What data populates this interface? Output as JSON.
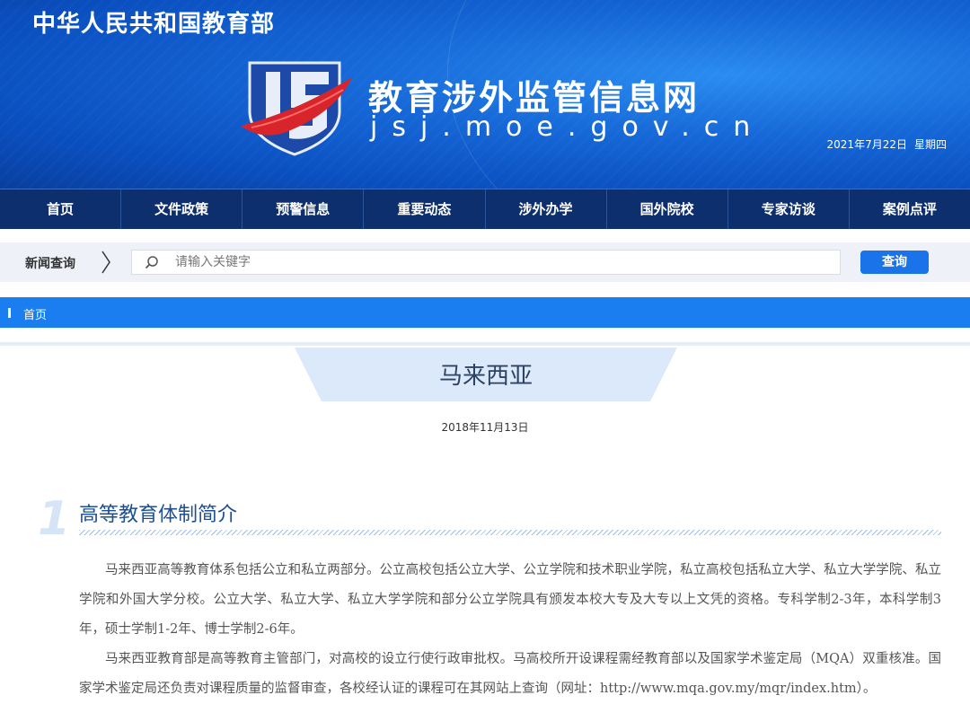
{
  "header": {
    "ministry": "中华人民共和国教育部",
    "site_title": "教育涉外监管信息网",
    "domain": "jsj.moe.gov.cn",
    "date": "2021年7月22日",
    "weekday": "星期四"
  },
  "nav": {
    "items": [
      {
        "label": "首页"
      },
      {
        "label": "文件政策"
      },
      {
        "label": "预警信息"
      },
      {
        "label": "重要动态"
      },
      {
        "label": "涉外办学"
      },
      {
        "label": "国外院校"
      },
      {
        "label": "专家访谈"
      },
      {
        "label": "案例点评"
      }
    ]
  },
  "search": {
    "label": "新闻查询",
    "placeholder": "请输入关键字",
    "value": "",
    "button_label": "查询"
  },
  "breadcrumb": {
    "home": "首页"
  },
  "article": {
    "title": "马来西亚",
    "date": "2018年11月13日",
    "section": {
      "number": "1",
      "title": "高等教育体制简介"
    },
    "paragraphs": [
      "马来西亚高等教育体系包括公立和私立两部分。公立高校包括公立大学、公立学院和技术职业学院，私立高校包括私立大学、私立大学学院、私立学院和外国大学分校。公立大学、私立大学、私立大学学院和部分公立学院具有颁发本校大专及大专以上文凭的资格。专科学制2-3年，本科学制3年，硕士学制1-2年、博士学制2-6年。",
      "马来西亚教育部是高等教育主管部门，对高校的设立行使行政审批权。马高校所开设课程需经教育部以及国家学术鉴定局（MQA）双重核准。国家学术鉴定局还负责对课程质量的监督审查，各校经认证的课程可在其网站上查询（网址：http://www.mqa.gov.my/mqr/index.htm）。"
    ]
  },
  "colors": {
    "banner": "#1566d6",
    "nav_bg": "#0d2f6e",
    "accent": "#1a7ef0",
    "section_title": "#1d4f91"
  }
}
